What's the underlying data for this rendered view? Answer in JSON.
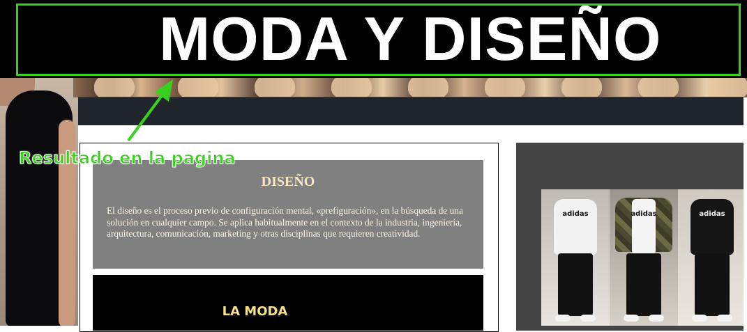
{
  "header": {
    "title": "MODA Y DISEÑO"
  },
  "annotation": {
    "label": "Resultado en la pagina"
  },
  "diseno": {
    "title": "DISEÑO",
    "text": "El diseño es el proceso previo de configuración mental, «prefiguración», en la búsqueda de una solución en cualquier campo. Se aplica habitualmente en el contexto de la industria, ingeniería, arquitectura, comunicación, marketing y otras disciplinas que requieren creatividad."
  },
  "moda": {
    "title": "LA MODA"
  },
  "collage": {
    "logo_text": "adidas"
  },
  "colors": {
    "highlight": "#39d120",
    "title_bg": "#000000",
    "card_bg": "#808080",
    "nav_bg": "#20262b"
  }
}
